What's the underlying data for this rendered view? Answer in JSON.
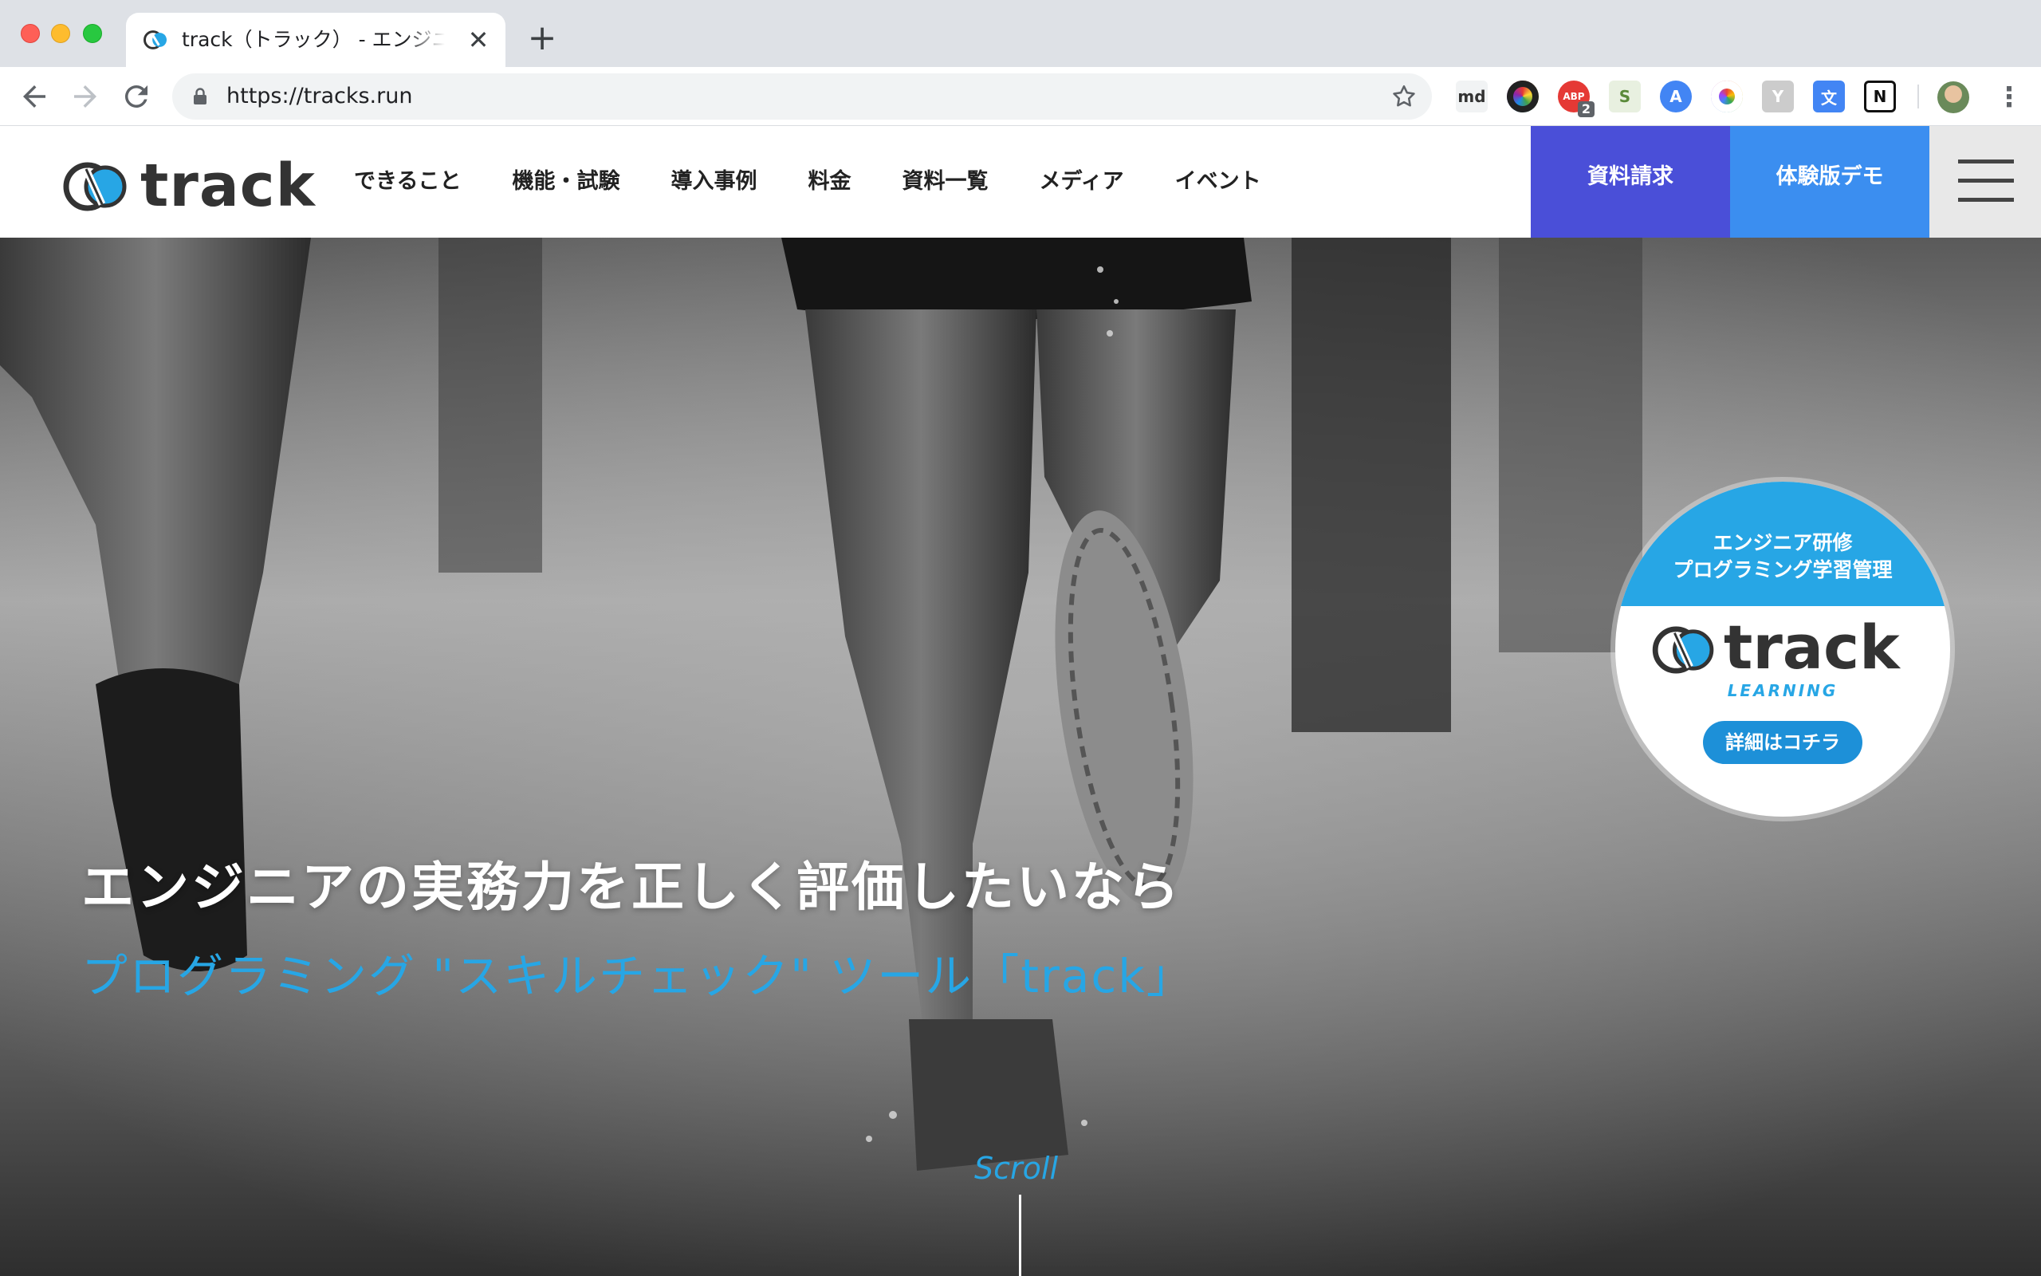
{
  "browser": {
    "tab_title": "track（トラック） - エンジニアの",
    "url": "https://tracks.run",
    "extensions": [
      {
        "name": "md-icon",
        "label": "md",
        "bg": "#f1f3f4",
        "fg": "#333333"
      },
      {
        "name": "color-wheel-dark-icon",
        "label": "",
        "bg": "#222222",
        "fg": "#ffffff"
      },
      {
        "name": "adblock-icon",
        "label": "ABP",
        "bg": "#e53935",
        "fg": "#ffffff",
        "badge": "2"
      },
      {
        "name": "sheet-extension-icon",
        "label": "S",
        "bg": "#e8f0e0",
        "fg": "#5a8a3a"
      },
      {
        "name": "a-arrow-icon",
        "label": "A",
        "bg": "#4285f4",
        "fg": "#ffffff"
      },
      {
        "name": "color-ring-icon",
        "label": "",
        "bg": "#ffffff",
        "fg": "#ffffff"
      },
      {
        "name": "y-icon",
        "label": "Y",
        "bg": "#cccccc",
        "fg": "#ffffff"
      },
      {
        "name": "translate-icon",
        "label": "文",
        "bg": "#4285f4",
        "fg": "#ffffff"
      },
      {
        "name": "notion-icon",
        "label": "N",
        "bg": "#ffffff",
        "fg": "#111111"
      }
    ]
  },
  "site": {
    "logo_text": "track",
    "nav": [
      "できること",
      "機能・試験",
      "導入事例",
      "料金",
      "資料一覧",
      "メディア",
      "イベント"
    ],
    "cta_request": "資料請求",
    "cta_demo": "体験版デモ"
  },
  "hero": {
    "title": "エンジニアの実務力を正しく評価したいなら",
    "subtitle": "プログラミング \"スキルチェック\" ツール「track」",
    "scroll_label": "Scroll"
  },
  "badge": {
    "line1": "エンジニア研修",
    "line2": "プログラミング学習管理",
    "logo_text": "track",
    "learning": "LEARNING",
    "button": "詳細はコチラ"
  },
  "colors": {
    "accent_blue": "#27a6e5",
    "cta_request": "#4a4fd8",
    "cta_demo": "#3b8ef0"
  }
}
